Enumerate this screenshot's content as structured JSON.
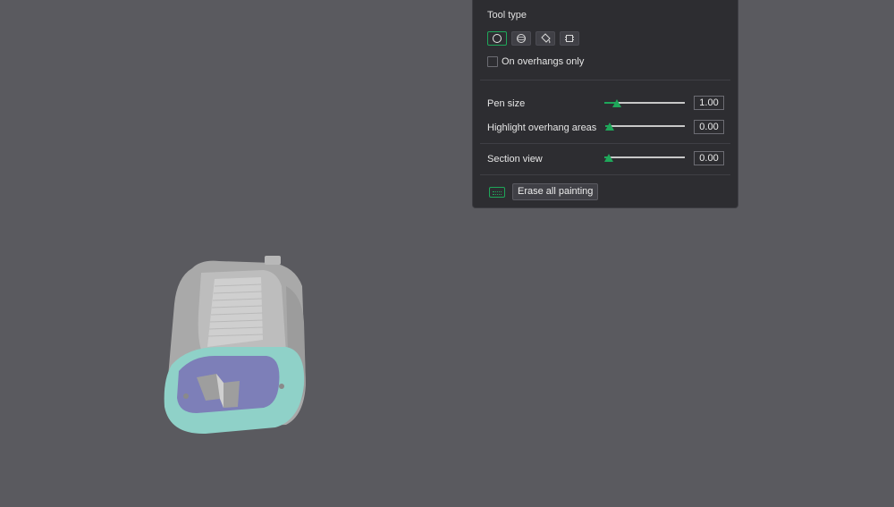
{
  "panel": {
    "tool_type_label": "Tool type",
    "tools": [
      {
        "name": "circle",
        "icon": "circle-icon",
        "active": true
      },
      {
        "name": "sphere",
        "icon": "sphere-icon",
        "active": false
      },
      {
        "name": "fill",
        "icon": "bucket-fill-icon",
        "active": false
      },
      {
        "name": "gap-fill",
        "icon": "gap-fill-icon",
        "active": false
      }
    ],
    "overhangs_only_label": "On overhangs only",
    "overhangs_only_checked": false,
    "pen_size": {
      "label": "Pen size",
      "value": "1.00",
      "fraction": 0.1
    },
    "highlight": {
      "label": "Highlight overhang areas",
      "value": "0.00",
      "fraction": 0.0
    },
    "section_view": {
      "label": "Section view",
      "value": "0.00",
      "fraction": 0.0
    },
    "erase_label": "Erase all painting"
  },
  "colors": {
    "accent": "#1fa75a",
    "panel_bg": "#2d2d31",
    "viewport_bg": "#5a5a5f",
    "model_body": "#b4b4b4",
    "model_cap": "#8fd1c8",
    "model_face": "#7d7fb8"
  }
}
